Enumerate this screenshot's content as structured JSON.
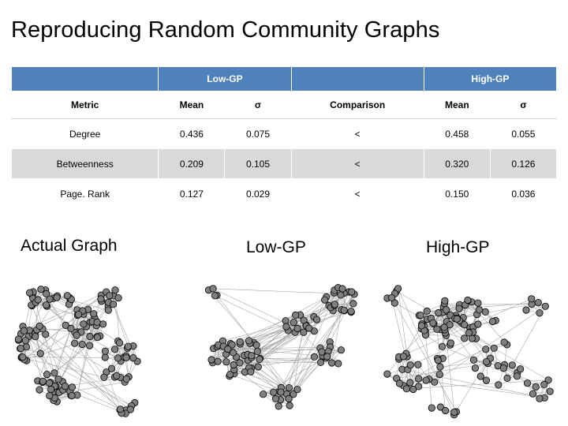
{
  "slide": {
    "title": "Reproducing Random Community Graphs"
  },
  "table": {
    "group_headers": {
      "blank": "",
      "low": "Low-GP",
      "blank2": "",
      "high": "High-GP"
    },
    "columns": [
      "Metric",
      "Mean",
      "σ",
      "Comparison",
      "Mean",
      "σ"
    ],
    "rows": [
      {
        "metric": "Degree",
        "low_mean": "0.436",
        "low_sd": "0.075",
        "comparison": "<",
        "high_mean": "0.458",
        "high_sd": "0.055"
      },
      {
        "metric": "Betweenness",
        "low_mean": "0.209",
        "low_sd": "0.105",
        "comparison": "<",
        "high_mean": "0.320",
        "high_sd": "0.126"
      },
      {
        "metric": "Page. Rank",
        "low_mean": "0.127",
        "low_sd": "0.029",
        "comparison": "<",
        "high_mean": "0.150",
        "high_sd": "0.036"
      }
    ],
    "header_color": "#4F81BD",
    "alt_row_color": "#D9D9D9"
  },
  "graphs": [
    {
      "id": "actual",
      "label": "Actual Graph"
    },
    {
      "id": "low",
      "label": "Low-GP"
    },
    {
      "id": "high",
      "label": "High-GP"
    }
  ],
  "graph_style": {
    "node_fill": "#808080",
    "node_stroke": "#000000",
    "edge_color": "#9a9a9a"
  }
}
